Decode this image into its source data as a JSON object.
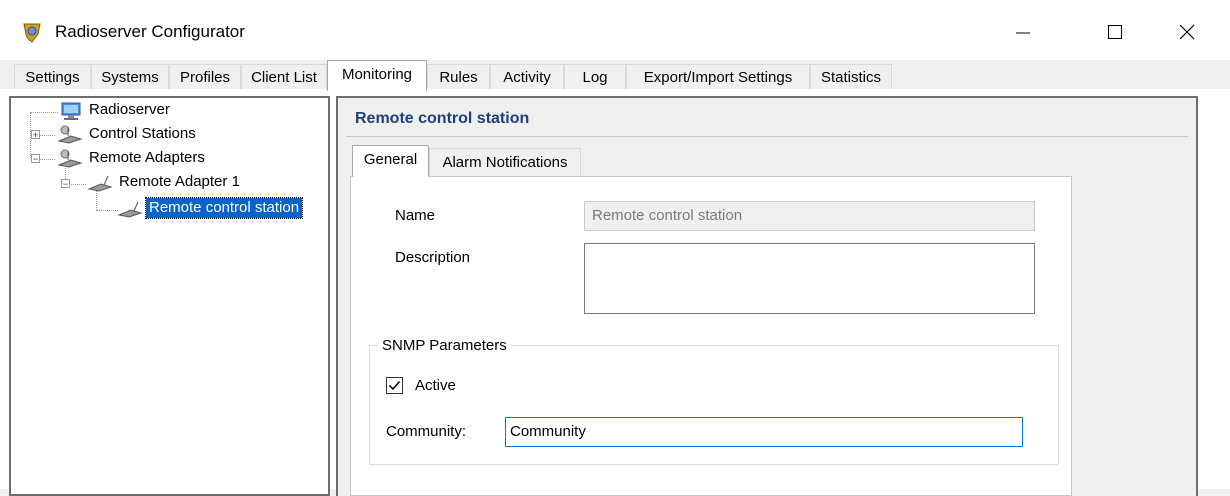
{
  "window": {
    "title": "Radioserver Configurator",
    "minimize_glyph": "—",
    "maximize_glyph": "☐",
    "close_glyph": "✕",
    "icon": "app-icon"
  },
  "main_tabs": [
    {
      "label": "Settings"
    },
    {
      "label": "Systems"
    },
    {
      "label": "Profiles"
    },
    {
      "label": "Client List"
    },
    {
      "label": "Monitoring",
      "active": true
    },
    {
      "label": "Rules"
    },
    {
      "label": "Activity"
    },
    {
      "label": "Log"
    },
    {
      "label": "Export/Import Settings"
    },
    {
      "label": "Statistics"
    }
  ],
  "tree": {
    "root": "Radioserver",
    "control_stations": "Control Stations",
    "remote_adapters": "Remote Adapters",
    "remote_adapter_1": "Remote Adapter 1",
    "selected": "Remote control station",
    "expand_glyph": "+",
    "collapse_glyph": "−"
  },
  "panel": {
    "header": "Remote control station",
    "tabs": [
      {
        "label": "General",
        "active": true
      },
      {
        "label": "Alarm Notifications"
      }
    ]
  },
  "general": {
    "name_label": "Name",
    "name_value": "Remote control station",
    "description_label": "Description",
    "description_value": "",
    "snmp_group": "SNMP Parameters",
    "active_label": "Active",
    "active_checked": true,
    "check_glyph": "✓",
    "community_label": "Community:",
    "community_value": "Community"
  },
  "colors": {
    "selection": "#0a64c8",
    "header_text": "#1f3f7a",
    "focus_border": "#0078d7"
  }
}
